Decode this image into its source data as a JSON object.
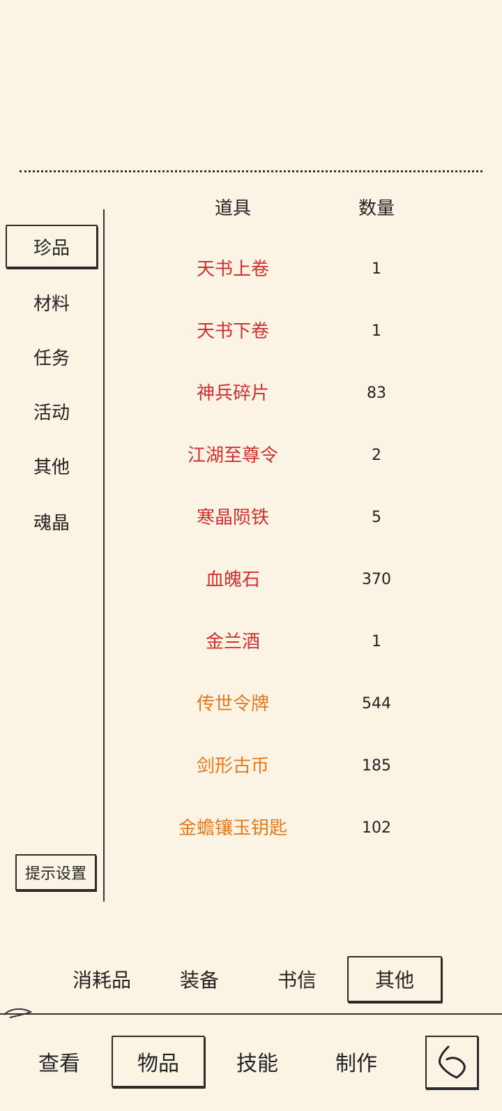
{
  "side_tabs": [
    {
      "label": "珍品",
      "active": true
    },
    {
      "label": "材料",
      "active": false
    },
    {
      "label": "任务",
      "active": false
    },
    {
      "label": "活动",
      "active": false
    },
    {
      "label": "其他",
      "active": false
    },
    {
      "label": "魂晶",
      "active": false
    }
  ],
  "hint_button": "提示设置",
  "table": {
    "headers": {
      "name": "道具",
      "quantity": "数量"
    },
    "rows": [
      {
        "name": "天书上卷",
        "qty": "1",
        "color": "#d0302f"
      },
      {
        "name": "天书下卷",
        "qty": "1",
        "color": "#d0302f"
      },
      {
        "name": "神兵碎片",
        "qty": "83",
        "color": "#d0302f"
      },
      {
        "name": "江湖至尊令",
        "qty": "2",
        "color": "#d0302f"
      },
      {
        "name": "寒晶陨铁",
        "qty": "5",
        "color": "#d0302f"
      },
      {
        "name": "血魄石",
        "qty": "370",
        "color": "#d0302f"
      },
      {
        "name": "金兰酒",
        "qty": "1",
        "color": "#d0302f"
      },
      {
        "name": "传世令牌",
        "qty": "544",
        "color": "#e07b22"
      },
      {
        "name": "剑形古币",
        "qty": "185",
        "color": "#e07b22"
      },
      {
        "name": "金蟾镶玉钥匙",
        "qty": "102",
        "color": "#e07b22"
      }
    ]
  },
  "category_tabs": [
    {
      "label": "消耗品",
      "active": false
    },
    {
      "label": "装备",
      "active": false
    },
    {
      "label": "书信",
      "active": false
    },
    {
      "label": "其他",
      "active": true
    }
  ],
  "nav": [
    {
      "label": "查看",
      "active": false
    },
    {
      "label": "物品",
      "active": true
    },
    {
      "label": "技能",
      "active": false
    },
    {
      "label": "制作",
      "active": false
    }
  ],
  "icons": {
    "back": "back-arrow-icon"
  }
}
